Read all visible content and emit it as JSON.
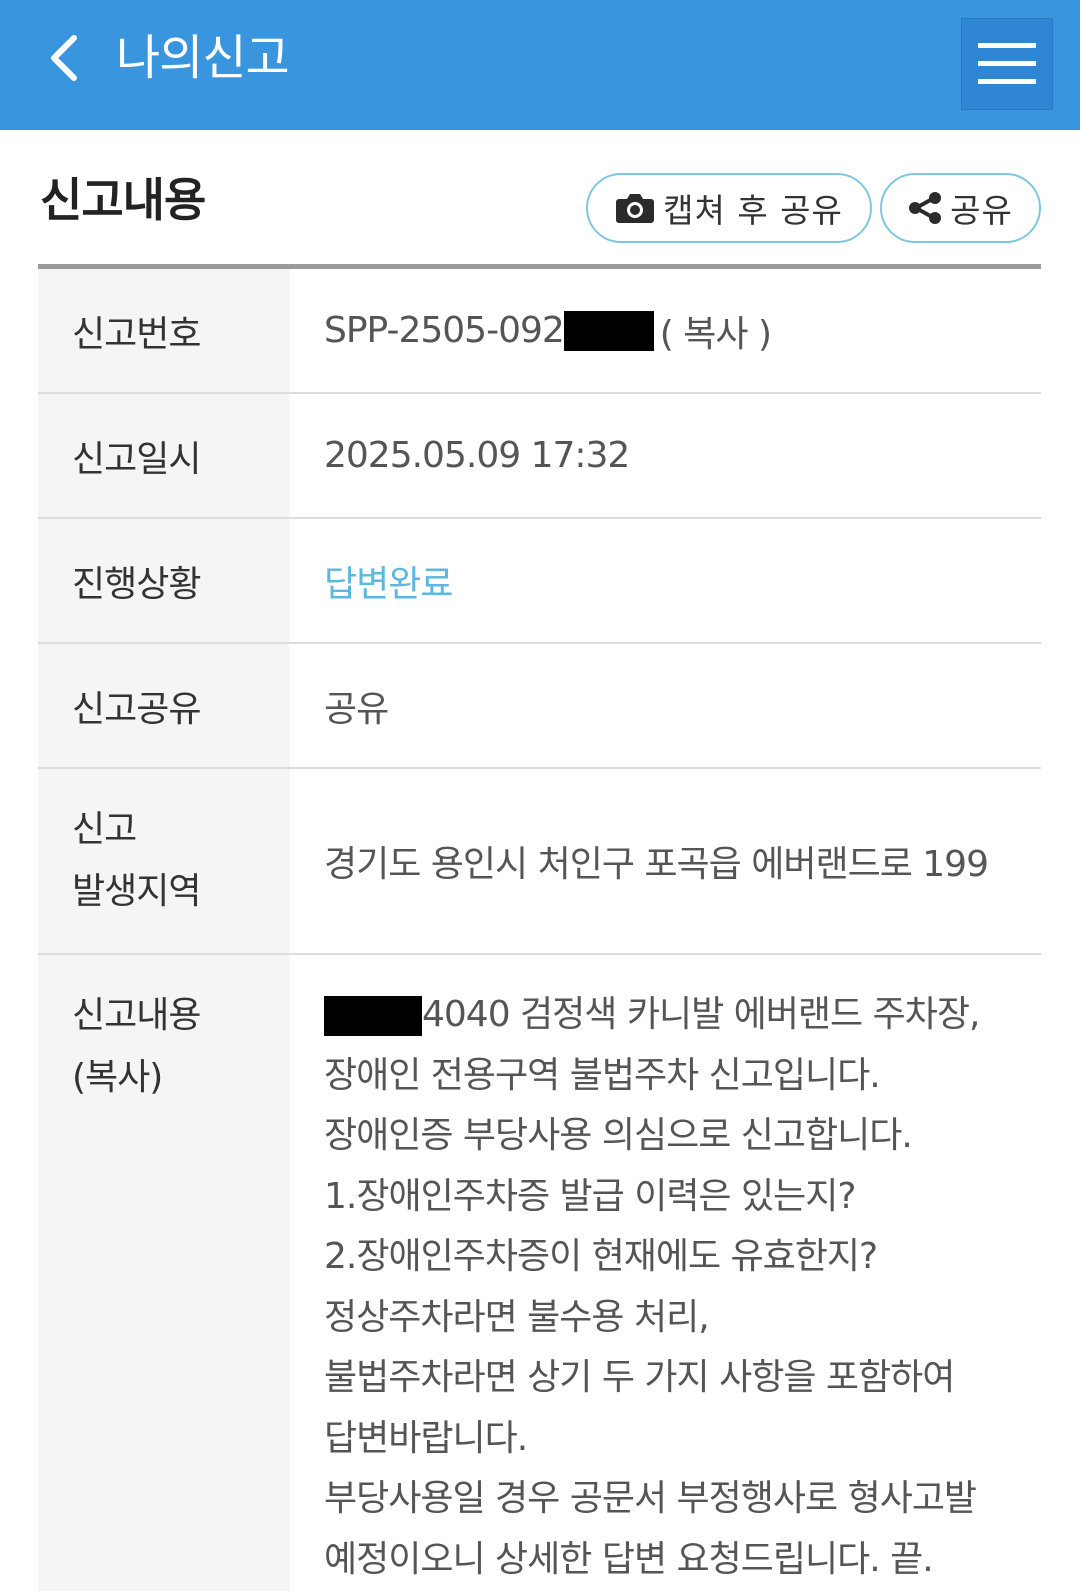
{
  "appbar": {
    "title": "나의신고",
    "back_icon": "chevron-left-icon",
    "menu_icon": "hamburger-menu-icon",
    "bg_color": "#3a95df"
  },
  "section": {
    "title": "신고내용",
    "capture_share_label": "캡쳐 후 공유",
    "share_label": "공유",
    "capture_icon": "camera-icon",
    "share_icon": "share-icon"
  },
  "details": {
    "report_number": {
      "label": "신고번호",
      "value": "SPP-2505-092",
      "copy_label": "( 복사 )"
    },
    "report_datetime": {
      "label": "신고일시",
      "value": "2025.05.09 17:32"
    },
    "progress": {
      "label": "진행상황",
      "value": "답변완료",
      "color": "#5bb8de"
    },
    "sharing": {
      "label": "신고공유",
      "value": "공유"
    },
    "location": {
      "label_line1": "신고",
      "label_line2": "발생지역",
      "value": "경기도 용인시 처인구 포곡읍 에버랜드로 199"
    },
    "content": {
      "label_line1": "신고내용",
      "label_line2": "(복사)",
      "first_line_suffix": "4040 검정색 카니발 에버랜드 주차장,",
      "lines": [
        "장애인 전용구역 불법주차 신고입니다.",
        "장애인증 부당사용 의심으로 신고합니다.",
        "1.장애인주차증 발급 이력은 있는지?",
        "2.장애인주차증이 현재에도 유효한지?",
        "정상주차라면 불수용 처리,",
        "불법주차라면 상기 두 가지 사항을 포함하여",
        "답변바랍니다.",
        "부당사용일 경우 공문서 부정행사로 형사고발",
        "예정이오니 상세한 답변 요청드립니다. 끝."
      ]
    }
  }
}
